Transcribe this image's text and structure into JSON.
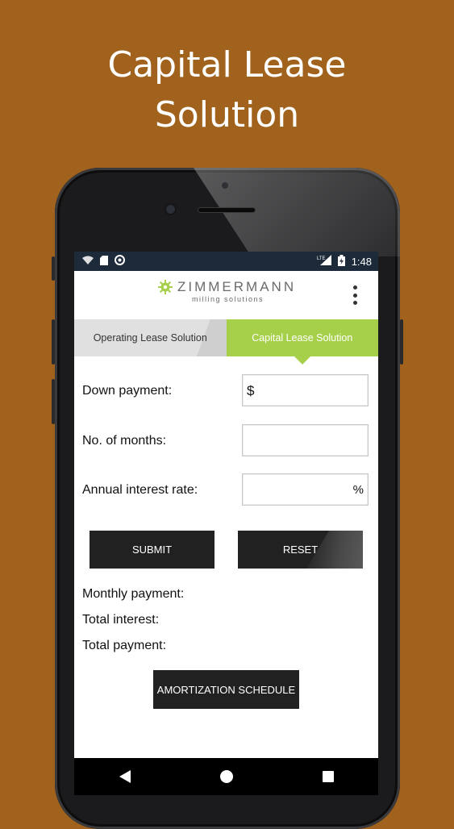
{
  "headline": {
    "line1": "Capital Lease",
    "line2": "Solution"
  },
  "statusbar": {
    "time": "1:48",
    "network": "LTE"
  },
  "logo": {
    "name": "ZIMMERMANN",
    "tagline": "milling solutions"
  },
  "tabs": [
    {
      "label": "Operating Lease Solution",
      "active": false
    },
    {
      "label": "Capital Lease Solution",
      "active": true
    }
  ],
  "form": {
    "down_payment": {
      "label": "Down payment:",
      "prefix": "$",
      "value": ""
    },
    "months": {
      "label": "No. of months:",
      "value": ""
    },
    "interest": {
      "label": "Annual interest rate:",
      "suffix": "%",
      "value": ""
    }
  },
  "buttons": {
    "submit": "SUBMIT",
    "reset": "RESET",
    "schedule": "AMORTIZATION SCHEDULE"
  },
  "results": {
    "monthly": "Monthly payment:",
    "interest": "Total interest:",
    "total": "Total payment:"
  },
  "colors": {
    "background": "#a0621c",
    "accent": "#a6d04a",
    "button": "#212121"
  }
}
